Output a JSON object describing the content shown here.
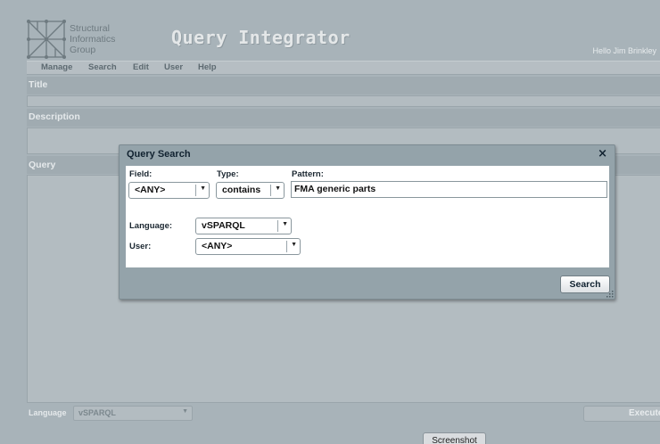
{
  "header": {
    "org_lines": [
      "Structural",
      "Informatics",
      "Group"
    ],
    "app_title": "Query Integrator",
    "greeting": "Hello Jim Brinkley"
  },
  "menu": {
    "items": [
      "Manage",
      "Search",
      "Edit",
      "User",
      "Help"
    ]
  },
  "page": {
    "title_label": "Title",
    "description_label": "Description",
    "query_label": "Query",
    "language_label": "Language",
    "language_value": "vSPARQL",
    "execute_label": "Execute",
    "screenshot_label": "Screenshot"
  },
  "dialog": {
    "title": "Query Search",
    "close_glyph": "×",
    "field_label": "Field:",
    "field_value": "<ANY>",
    "type_label": "Type:",
    "type_value": "contains",
    "pattern_label": "Pattern:",
    "pattern_value": "FMA generic parts",
    "language_label": "Language:",
    "language_value": "vSPARQL",
    "user_label": "User:",
    "user_value": "<ANY>",
    "search_button": "Search",
    "dropdown_glyph": "▼"
  },
  "colors": {
    "overlay_bg": "#a8b3b9",
    "dialog_bg": "#94a3aa",
    "dialog_body": "#ffffff",
    "title_text": "#112230"
  }
}
